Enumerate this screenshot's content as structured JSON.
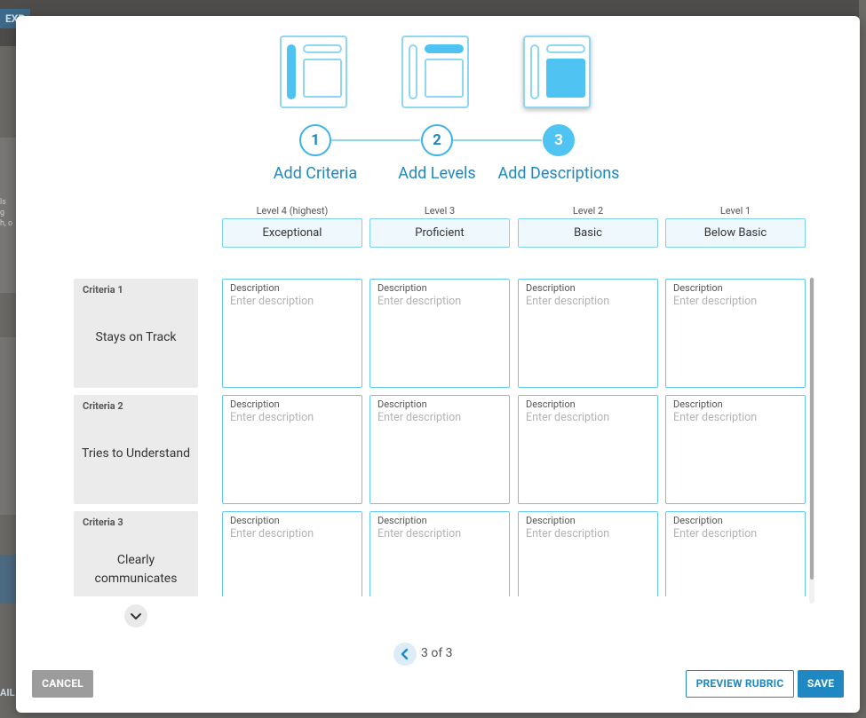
{
  "background": {
    "tag": "EXP",
    "side_text": [
      "ls",
      "g",
      "h, o"
    ],
    "bottom_text": "AIL"
  },
  "steps": [
    {
      "number": "1",
      "label": "Add Criteria"
    },
    {
      "number": "2",
      "label": "Add Levels"
    },
    {
      "number": "3",
      "label": "Add Descriptions"
    }
  ],
  "active_step": 3,
  "levels": [
    {
      "caption": "Level 4 (highest)",
      "name": "Exceptional"
    },
    {
      "caption": "Level 3",
      "name": "Proficient"
    },
    {
      "caption": "Level 2",
      "name": "Basic"
    },
    {
      "caption": "Level 1",
      "name": "Below Basic"
    }
  ],
  "criteria": [
    {
      "number": "Criteria 1",
      "name": "Stays on Track"
    },
    {
      "number": "Criteria 2",
      "name": "Tries to Understand"
    },
    {
      "number": "Criteria 3",
      "name": "Clearly communicates"
    }
  ],
  "cell": {
    "label": "Description",
    "placeholder": "Enter description"
  },
  "pagination": {
    "text": "3 of 3"
  },
  "buttons": {
    "cancel": "CANCEL",
    "preview": "PREVIEW RUBRIC",
    "save": "SAVE"
  },
  "colors": {
    "accent": "#1f88c2",
    "light_accent": "#4fc3f2",
    "border": "#63c8ef"
  }
}
